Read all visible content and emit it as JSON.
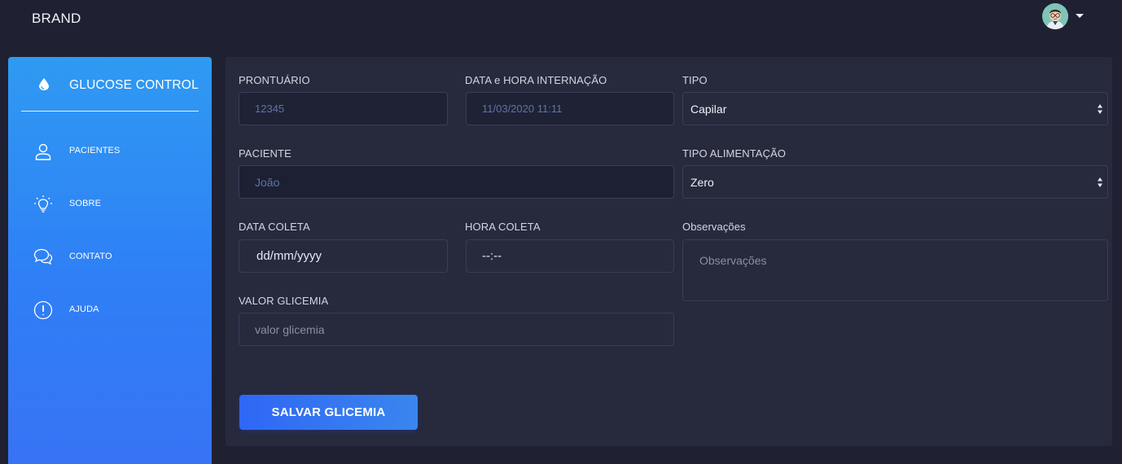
{
  "header": {
    "brand": "BRAND",
    "avatar_icon": "user-avatar-icon",
    "menu_icon": "caret-down-icon"
  },
  "sidebar": {
    "title": "GLUCOSE CONTROL",
    "title_icon": "drop-icon",
    "items": [
      {
        "label": "PACIENTES",
        "icon": "user-icon"
      },
      {
        "label": "SOBRE",
        "icon": "lightbulb-icon"
      },
      {
        "label": "CONTATO",
        "icon": "chat-bubbles-icon"
      },
      {
        "label": "AJUDA",
        "icon": "exclamation-circle-icon"
      }
    ]
  },
  "form": {
    "prontuario": {
      "label": "PRONTUÁRIO",
      "value": "12345"
    },
    "data_internacao": {
      "label": "DATA e HORA INTERNAÇÃO",
      "value": "11/03/2020 11:11"
    },
    "tipo": {
      "label": "TIPO",
      "selected": "Capilar"
    },
    "paciente": {
      "label": "PACIENTE",
      "value": "João"
    },
    "tipo_alimentacao": {
      "label": "TIPO ALIMENTAÇÃO",
      "selected": "Zero"
    },
    "data_coleta": {
      "label": "DATA COLETA",
      "value": "dd/mm/yyyy"
    },
    "hora_coleta": {
      "label": "HORA COLETA",
      "value": "--:--"
    },
    "observacoes": {
      "label": "Observações",
      "placeholder": "Observações"
    },
    "valor_glicemia": {
      "label": "VALOR GLICEMIA",
      "placeholder": "valor glicemia"
    },
    "submit_label": "SALVAR GLICEMIA"
  },
  "colors": {
    "background": "#1f2133",
    "panel": "#272a3d",
    "sidebar_top": "#2f9af2",
    "sidebar_bottom": "#3873f5",
    "button": "#2f67f5"
  }
}
